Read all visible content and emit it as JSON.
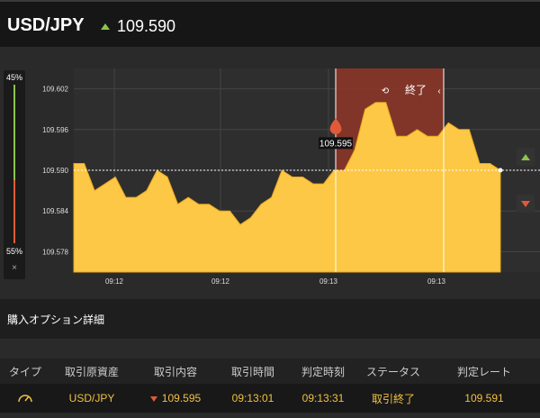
{
  "header": {
    "pair": "USD/JPY",
    "price": "109.590",
    "direction_icon": "up-arrow-icon",
    "direction_color": "#8ac44a"
  },
  "gauge": {
    "top_label": "45%",
    "bottom_label": "55%",
    "close_label": "×",
    "high_percent": 45,
    "low_percent": 55
  },
  "chart": {
    "ylabels": [
      "109.602",
      "109.596",
      "109.590",
      "109.584",
      "109.578"
    ],
    "xlabels": [
      "09:12",
      "09:12",
      "09:13",
      "09:13"
    ],
    "expiry_label": "終了",
    "marker_price": "109.595",
    "current_price": 109.59,
    "entry_price": 109.595,
    "fill_color": "#fcc845",
    "expiry_band_color": "#8b3528"
  },
  "chart_data": {
    "type": "area",
    "ylim": [
      109.575,
      109.605
    ],
    "series": [
      {
        "values": [
          109.591,
          109.591,
          109.587,
          109.588,
          109.589,
          109.586,
          109.586,
          109.587,
          109.59,
          109.589,
          109.585,
          109.586,
          109.585,
          109.585,
          109.584,
          109.584,
          109.582,
          109.583,
          109.585,
          109.586,
          109.59,
          109.589,
          109.589,
          109.588,
          109.588,
          109.59,
          109.59,
          109.593,
          109.599,
          109.6,
          109.6,
          109.595,
          109.595,
          109.596,
          109.595,
          109.595,
          109.597,
          109.596,
          109.596,
          109.591,
          109.591,
          109.59
        ],
        "color": "#fcc845"
      }
    ]
  },
  "section": {
    "title": "購入オプション詳細"
  },
  "table": {
    "headers": [
      "タイプ",
      "取引原資産",
      "取引内容",
      "取引時間",
      "判定時刻",
      "ステータス",
      "判定レート"
    ],
    "row": {
      "type_icon": "timer-icon",
      "asset": "USD/JPY",
      "content": "109.595",
      "content_icon": "down-arrow-icon",
      "trade_time": "09:13:01",
      "judge_time": "09:13:31",
      "status": "取引終了",
      "rate": "109.591"
    }
  }
}
